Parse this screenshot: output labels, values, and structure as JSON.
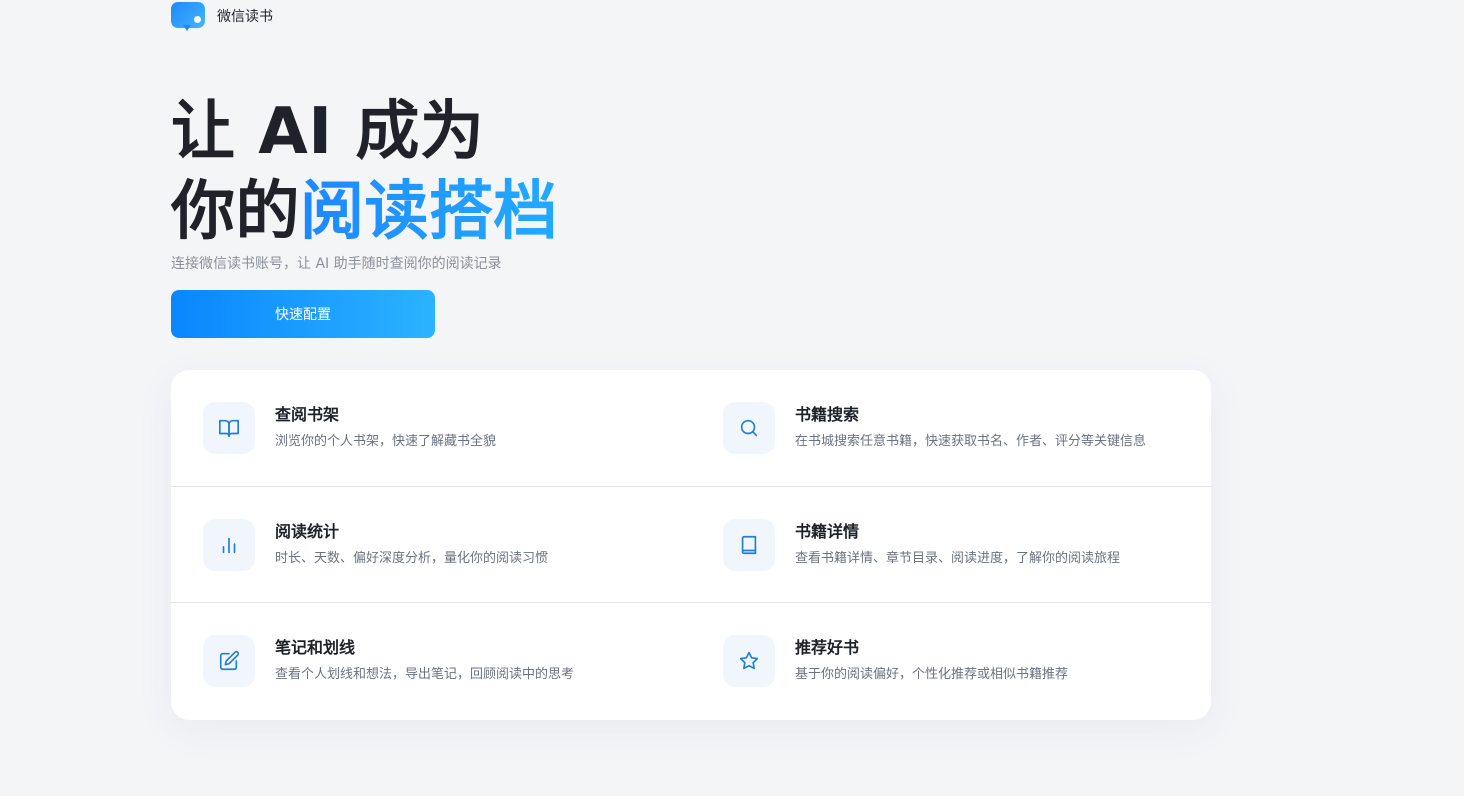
{
  "brand": {
    "name": "微信读书",
    "logo_icon": "chat-bubble-icon"
  },
  "hero": {
    "title_line1": "让 AI 成为",
    "title_line2_plain": "你的",
    "title_line2_accent": "阅读搭档",
    "subtitle": "连接微信读书账号，让 AI 助手随时查阅你的阅读记录",
    "cta_label": "快速配置"
  },
  "colors": {
    "accent": "#1e88ff",
    "accent_light": "#2bb3ff",
    "icon_bg": "#f1f6fd",
    "page_bg": "#f4f5f7"
  },
  "features": [
    {
      "icon": "book-open-icon",
      "title": "查阅书架",
      "desc": "浏览你的个人书架，快速了解藏书全貌"
    },
    {
      "icon": "search-icon",
      "title": "书籍搜索",
      "desc": "在书城搜索任意书籍，快速获取书名、作者、评分等关键信息"
    },
    {
      "icon": "bar-chart-icon",
      "title": "阅读统计",
      "desc": "时长、天数、偏好深度分析，量化你的阅读习惯"
    },
    {
      "icon": "book-icon",
      "title": "书籍详情",
      "desc": "查看书籍详情、章节目录、阅读进度，了解你的阅读旅程"
    },
    {
      "icon": "edit-icon",
      "title": "笔记和划线",
      "desc": "查看个人划线和想法，导出笔记，回顾阅读中的思考"
    },
    {
      "icon": "star-icon",
      "title": "推荐好书",
      "desc": "基于你的阅读偏好，个性化推荐或相似书籍推荐"
    }
  ]
}
